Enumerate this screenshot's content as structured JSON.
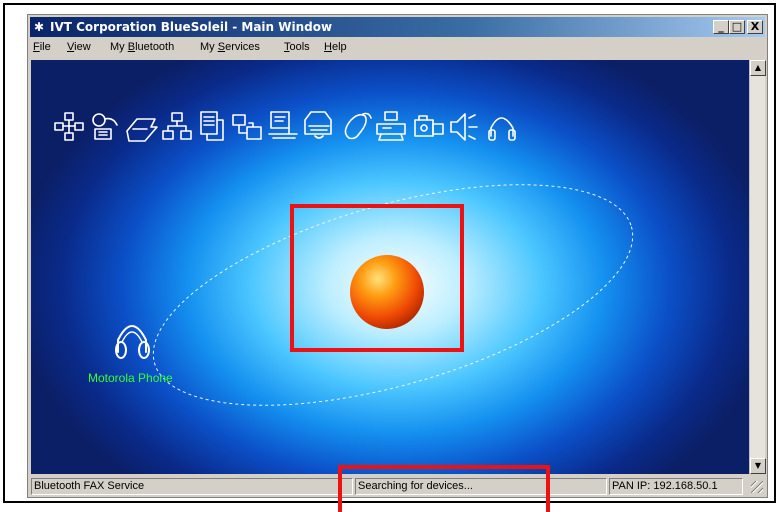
{
  "window": {
    "title": "IVT Corporation BlueSoleil - Main Window",
    "controls": {
      "minimize": "_",
      "maximize": "□",
      "close": "X"
    }
  },
  "menu": [
    {
      "label": "File",
      "mnemonic": "F",
      "rest": "ile"
    },
    {
      "label": "View",
      "mnemonic": "V",
      "rest": "iew"
    },
    {
      "label": "My Bluetooth",
      "pre": "My ",
      "mnemonic": "B",
      "rest": "luetooth"
    },
    {
      "label": "My Services",
      "pre": "My ",
      "mnemonic": "S",
      "rest": "ervices"
    },
    {
      "label": "Tools",
      "mnemonic": "T",
      "rest": "ools"
    },
    {
      "label": "Help",
      "mnemonic": "H",
      "rest": "elp"
    }
  ],
  "service_icons": [
    "network-access-icon",
    "dialup-networking-icon",
    "file-transfer-icon",
    "lan-access-icon",
    "object-push-icon",
    "sync-icon",
    "personal-area-network-icon",
    "printer-icon",
    "mouse-hid-icon",
    "fax-icon",
    "camera-imaging-icon",
    "audio-speaker-icon",
    "headset-icon"
  ],
  "device": {
    "label": "Motorola Phone",
    "icon": "headset-icon"
  },
  "status": {
    "left": "Bluetooth FAX Service",
    "center": "Searching for devices...",
    "right": "PAN IP: 192.168.50.1"
  },
  "colors": {
    "highlight": "#ee1111",
    "device_label": "#33ff33",
    "title_bar": "#0a246a"
  }
}
